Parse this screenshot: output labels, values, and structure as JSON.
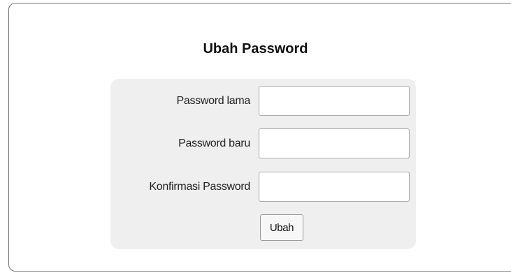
{
  "form": {
    "title": "Ubah Password",
    "fields": [
      {
        "label": "Password lama",
        "value": "",
        "placeholder": ""
      },
      {
        "label": "Password baru",
        "value": "",
        "placeholder": ""
      },
      {
        "label": "Konfirmasi Password",
        "value": "",
        "placeholder": ""
      }
    ],
    "submit_label": "Ubah"
  },
  "colors": {
    "panel_border": "#6f6f6f",
    "form_background": "#efefef",
    "input_border": "#a9a9a9"
  }
}
